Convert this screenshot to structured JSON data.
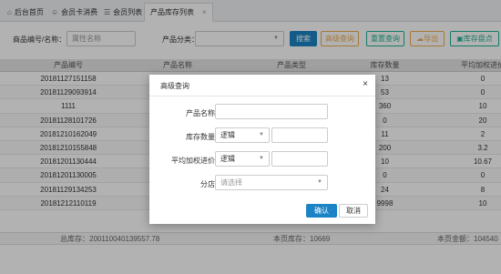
{
  "tabs": [
    {
      "label": "后台首页",
      "icon": "home-icon",
      "active": false
    },
    {
      "label": "会员卡消费",
      "icon": "user-icon",
      "active": false
    },
    {
      "label": "会员列表",
      "icon": "list-icon",
      "active": false
    },
    {
      "label": "产品库存列表",
      "icon": "",
      "active": true,
      "close": "×"
    }
  ],
  "search": {
    "code_label": "商品编号/名称：",
    "code_placeholder": "属性名称",
    "category_label": "产品分类：",
    "category_value": "",
    "search_btn": "搜索",
    "advanced_btn": "高级查询",
    "reset_btn": "重置查询",
    "export_btn": "导出",
    "inventory_btn": "库存盘点"
  },
  "table": {
    "headers": [
      "产品编号",
      "产品名称",
      "产品类型",
      "库存数量",
      "平均加权进价"
    ],
    "rows": [
      [
        "20181127151158",
        "",
        "",
        "13",
        "0"
      ],
      [
        "20181129093914",
        "",
        "",
        "53",
        "0"
      ],
      [
        "1111",
        "",
        "",
        "360",
        "10"
      ],
      [
        "20181128101726",
        "",
        "",
        "0",
        "20"
      ],
      [
        "20181210162049",
        "",
        "",
        "11",
        "2"
      ],
      [
        "20181210155848",
        "",
        "",
        "200",
        "3.2"
      ],
      [
        "20181201130444",
        "",
        "",
        "10",
        "10.67"
      ],
      [
        "20181201130005",
        "",
        "",
        "0",
        "0"
      ],
      [
        "20181129134253",
        "",
        "",
        "24",
        "8"
      ],
      [
        "20181212110119",
        "",
        "",
        "9998",
        "10"
      ]
    ]
  },
  "footer": {
    "total_stock": "总库存：200110040139557.78",
    "page_stock": "本页库存：10669",
    "page_amount": "本页金额：104540"
  },
  "modal": {
    "title": "高级查询",
    "close": "×",
    "name_label": "产品名称：",
    "name_value": "",
    "stock_label": "库存数量：",
    "stock_logic": "逻辑",
    "stock_value": "",
    "price_label": "平均加权进价：",
    "price_logic": "逻辑",
    "price_value": "",
    "store_label": "分店：",
    "store_placeholder": "请选择",
    "ok_btn": "确认",
    "cancel_btn": "取消"
  },
  "colors": {
    "primary": "#1c84c6",
    "warning": "#f0ad4e",
    "success": "#1ab394"
  }
}
